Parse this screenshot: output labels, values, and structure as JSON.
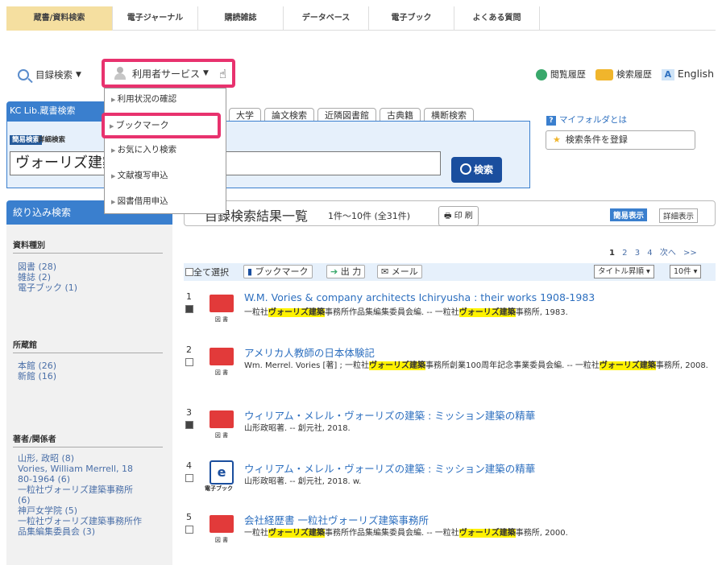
{
  "topnav": [
    {
      "label": "蔵書/資料検索",
      "active": true,
      "w": 132
    },
    {
      "label": "電子ジャーナル",
      "active": false,
      "w": 106
    },
    {
      "label": "購読雑誌",
      "active": false,
      "w": 106
    },
    {
      "label": "データベース",
      "active": false,
      "w": 106
    },
    {
      "label": "電子ブック",
      "active": false,
      "w": 106
    },
    {
      "label": "よくある質問",
      "active": false,
      "w": 106
    }
  ],
  "searchbar": {
    "catalog_search": "目録検索",
    "user_service": "利用者サービス",
    "history": "閲覧履歴",
    "search_history": "検索履歴",
    "language": "English"
  },
  "dropdown": {
    "items": [
      "利用状況の確認",
      "ブックマーク",
      "お気に入り検索",
      "文献複写申込",
      "図書借用申込"
    ]
  },
  "search_panel": {
    "kc_label": "KC Lib.蔵書検索",
    "tabs": [
      "大学",
      "論文検索",
      "近隣図書館",
      "古典籍",
      "横断検索"
    ],
    "simple": "簡易検索",
    "detail": "詳細検索",
    "query": "ヴォーリズ建築",
    "search_button": "検索",
    "myfolder": "マイフォルダとは",
    "save_condition": "検索条件を登録"
  },
  "sidebar": {
    "title": "絞り込み検索",
    "sections": [
      {
        "name": "資料種別",
        "items": [
          "図書 (28)",
          "雑誌 (2)",
          "電子ブック (1)"
        ]
      },
      {
        "name": "所蔵館",
        "items": [
          "本館 (26)",
          "新館 (16)"
        ]
      },
      {
        "name": "著者/関係者",
        "items": [
          "山形, 政昭 (8)",
          "Vories, William Merrell, 18",
          "80-1964 (6)",
          "一粒社ヴォーリズ建築事務所",
          "(6)",
          "神戸女学院 (5)",
          "一粒社ヴォーリズ建築事務所作",
          "品集編集委員会 (3)"
        ]
      }
    ]
  },
  "results": {
    "heading": "目録検索結果一覧",
    "count": "1件～10件 (全31件)",
    "print": "印 刷",
    "view_simple": "簡易表示",
    "view_detail": "詳細表示",
    "pagination": {
      "current": "1",
      "pages": [
        "2",
        "3",
        "4"
      ],
      "next": "次へ",
      "last": ">>"
    },
    "toolbar": {
      "select_all": "全て選択",
      "bookmark": "ブックマーク",
      "output": "出 力",
      "mail": "メール",
      "sort": "タイトル昇順",
      "per_page": "10件"
    },
    "items": [
      {
        "num": "1",
        "checked": true,
        "type": "book",
        "label": "図 書",
        "title": "W.M. Vories & company architects Ichiryusha : their works 1908-1983",
        "meta": [
          {
            "t": "一粒社"
          },
          {
            "t": "ヴォーリズ建築",
            "h": true
          },
          {
            "t": "事務所作品集編集委員会編. -- 一粒社"
          },
          {
            "t": "ヴォーリズ建築",
            "h": true
          },
          {
            "t": "事務所, 1983."
          }
        ]
      },
      {
        "num": "2",
        "checked": false,
        "type": "book",
        "label": "図 書",
        "title": "アメリカ人教師の日本体験記",
        "meta": [
          {
            "t": "Wm. Merrel. Vories [著] ; 一粒社"
          },
          {
            "t": "ヴォーリズ建築",
            "h": true
          },
          {
            "t": "事務所創業100周年記念事業委員会編. -- 一粒社"
          },
          {
            "t": "ヴォーリズ建築",
            "h": true
          },
          {
            "t": "事務所, 2008."
          }
        ]
      },
      {
        "num": "3",
        "checked": true,
        "type": "book",
        "label": "図 書",
        "title": "ウィリアム・メレル・ヴォーリズの建築 : ミッション建築の精華",
        "meta": [
          {
            "t": "山形政昭著. -- 創元社, 2018."
          }
        ]
      },
      {
        "num": "4",
        "checked": false,
        "type": "ebook",
        "label": "電子ブック",
        "title": "ウィリアム・メレル・ヴォーリズの建築 : ミッション建築の精華",
        "meta": [
          {
            "t": "山形政昭著. -- 創元社, 2018. w."
          }
        ]
      },
      {
        "num": "5",
        "checked": false,
        "type": "book",
        "label": "図 書",
        "title": "会社経歴書 一粒社ヴォーリズ建築事務所",
        "meta": [
          {
            "t": "一粒社"
          },
          {
            "t": "ヴォーリズ建築",
            "h": true
          },
          {
            "t": "事務所作品集編集委員会編. -- 一粒社"
          },
          {
            "t": "ヴォーリズ建築",
            "h": true
          },
          {
            "t": "事務所, 2000."
          }
        ]
      }
    ]
  }
}
